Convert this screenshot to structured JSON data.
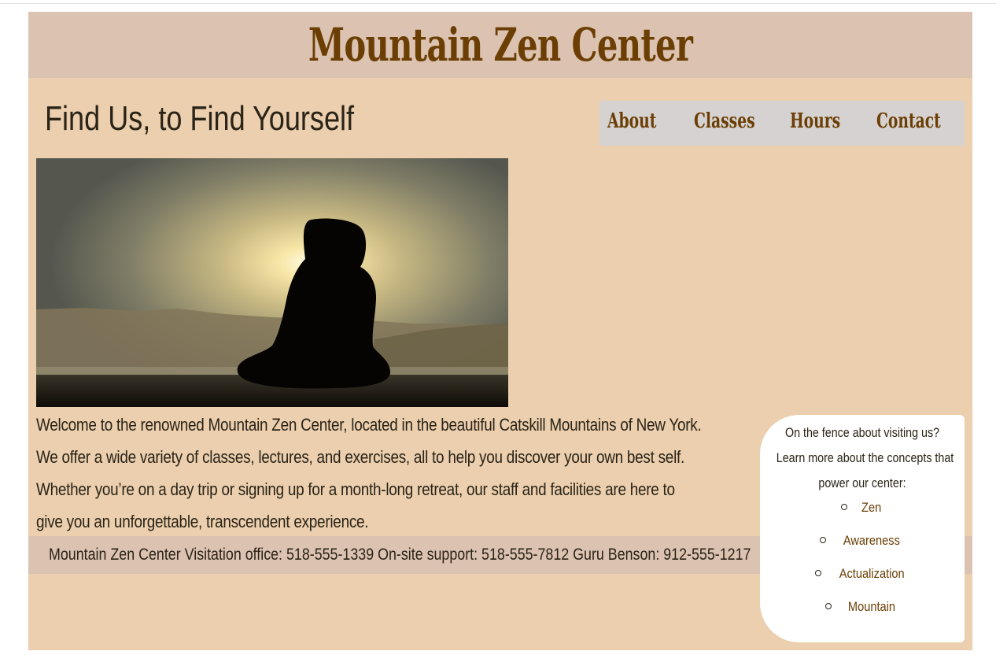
{
  "header": {
    "site_title": "Mountain Zen Center"
  },
  "tagline": "Find Us, to Find Yourself",
  "nav": {
    "items": [
      "About",
      "Classes",
      "Hours",
      "Contact"
    ]
  },
  "hero": {
    "icon": "meditation-silhouette-photo"
  },
  "welcome": {
    "lines": [
      "Welcome to the renowned Mountain Zen Center, located in the beautiful Catskill Mountains of New York.",
      "We offer a wide variety of classes, lectures, and exercises, all to help you discover your own best self.",
      "Whether you’re on a day trip or signing up for a month-long retreat, our staff and facilities are here to",
      "give you an unforgettable, transcendent experience."
    ]
  },
  "aside": {
    "intro_lines": [
      "On the fence about visiting us?",
      "Learn more about the concepts that",
      "power our center:"
    ],
    "concepts": [
      "Zen",
      "Awareness",
      "Actualization",
      "Mountain"
    ]
  },
  "footer": {
    "text": "Mountain Zen Center Visitation office: 518-555-1339 On-site support: 518-555-7812 Guru Benson: 912-555-1217"
  },
  "colors": {
    "page_background": "#ebcfae",
    "header_background": "#dcc3b1",
    "title_brown": "#6b3e04",
    "nav_background": "#d5d2d1",
    "aside_background": "#ffffff",
    "body_text": "#2a2317"
  }
}
